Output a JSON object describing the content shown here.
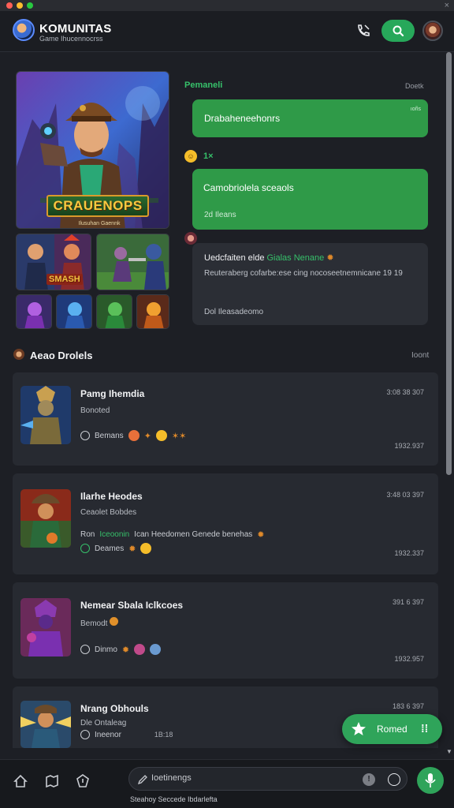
{
  "window": {
    "close_glyph": "×"
  },
  "header": {
    "title": "KOMUNITAS",
    "subtitle": "Game Ihucennocrss",
    "icons": [
      "phone-icon",
      "search-icon",
      "user-avatar"
    ]
  },
  "hero": {
    "title": "CRAUENOPS",
    "subtitle": "Ilusuhan Gaennk",
    "thumb_label": "SMASH"
  },
  "chat": {
    "heading": "Pemaneli",
    "time": "Doetk",
    "bubble1": {
      "text": "Drabaheneehonrs",
      "mark": "ıoñs"
    },
    "reaction_count": "1×",
    "bubble2": {
      "text": "Camobriolela sceaols",
      "meta": "2d Ileans"
    },
    "bubble3": {
      "line1_pre": "Uedcfaiten elde ",
      "line1_highlight": "Gialas Nenane",
      "line2": "Reuteraberg cofarbe:ese cing nocoseetnemnicane 19 19",
      "line3": "Dol Ileasadeomo"
    },
    "colors": {
      "accent": "#2f9a48",
      "accent_text": "#36c06a"
    }
  },
  "section": {
    "title": "Aeao Drolels",
    "link": "Ioont"
  },
  "cards": [
    {
      "title": "Pamg Ihemdia",
      "sub": "Bonoted",
      "meta": "Bemans",
      "ts": "3:08 38 307",
      "date": "1932.937"
    },
    {
      "title": "Ilarhe Heodes",
      "sub": "Ceaolet Bobdes",
      "meta_pre": "Ron ",
      "meta_hl": "Iceoonin",
      "meta_post": " Ican Heedomen  Genede benehas",
      "meta2": "Deames",
      "ts": "3:48 03 397",
      "date": "1932.337"
    },
    {
      "title": "Nemear Sbala Iclkcoes",
      "sub": "Bemodt",
      "meta": "Dinmo",
      "ts": "391 6 397",
      "date": "1932.957"
    },
    {
      "title": "Nrang Obhouls",
      "sub": "Dle Ontaleag",
      "meta": "Ineenor",
      "meta_extra": "1B:18",
      "ts": "183 6 397",
      "date": ""
    }
  ],
  "fab": {
    "label": "Romed"
  },
  "composer": {
    "placeholder": "Ioetinengs"
  },
  "footer": {
    "text": "Steahoy Seccede Ibdarlefta"
  }
}
